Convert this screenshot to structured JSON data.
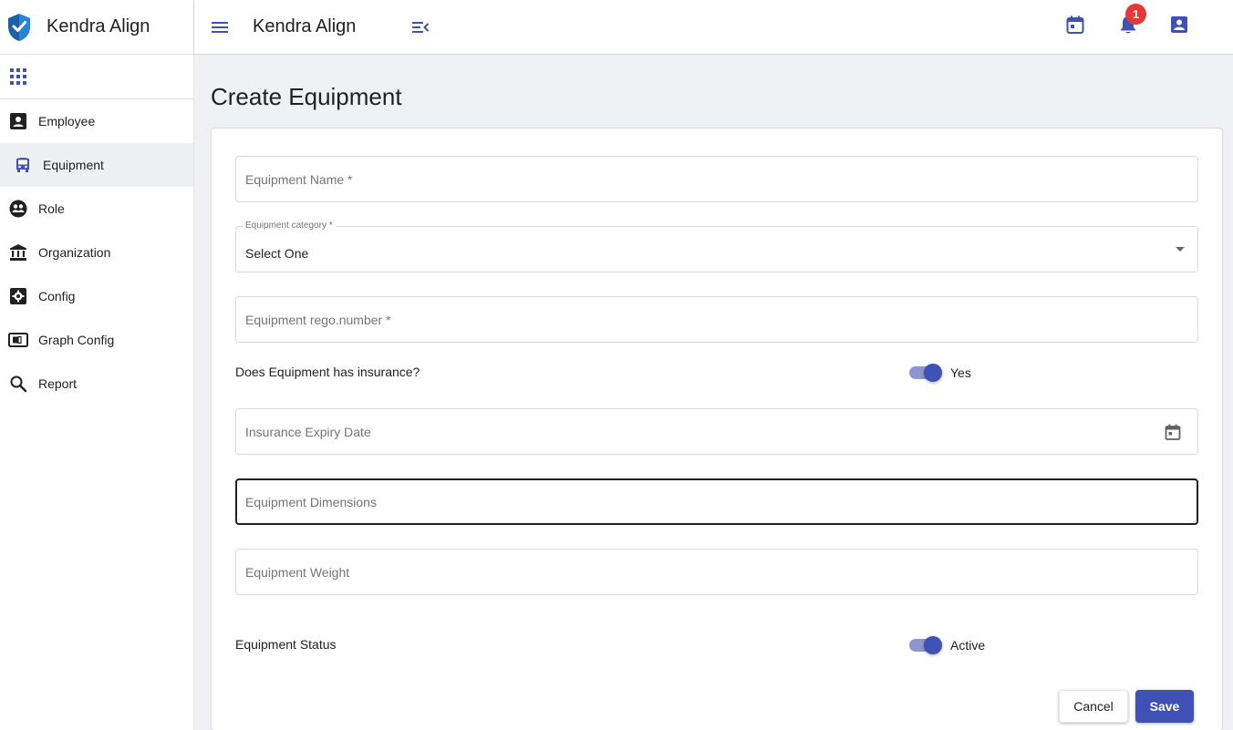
{
  "brand": {
    "name": "Kendra Align"
  },
  "colors": {
    "primary": "#3f51b5",
    "badge": "#e53935",
    "toggle_track": "#8e96cf",
    "main_bg": "#eff2f5"
  },
  "sidebar": {
    "items": [
      {
        "label": "Employee",
        "icon": "contact-card-icon"
      },
      {
        "label": "Equipment",
        "icon": "bus-icon",
        "active": true
      },
      {
        "label": "Role",
        "icon": "group-icon"
      },
      {
        "label": "Organization",
        "icon": "bank-icon"
      },
      {
        "label": "Config",
        "icon": "settings-box-icon"
      },
      {
        "label": "Graph Config",
        "icon": "switch-box-icon"
      },
      {
        "label": "Report",
        "icon": "search-icon"
      }
    ]
  },
  "header": {
    "title": "Kendra Align",
    "notification_count": "1"
  },
  "page": {
    "title": "Create Equipment"
  },
  "form": {
    "equipment_name": {
      "placeholder": "Equipment Name *"
    },
    "equipment_category": {
      "label": "Equipment category *",
      "value": "Select One"
    },
    "rego_number": {
      "placeholder": "Equipment rego.number *"
    },
    "insurance": {
      "label": "Does Equipment has insurance?",
      "toggle_label": "Yes",
      "checked": true
    },
    "insurance_expiry": {
      "placeholder": "Insurance Expiry Date"
    },
    "dimensions": {
      "placeholder": "Equipment Dimensions"
    },
    "weight": {
      "placeholder": "Equipment Weight"
    },
    "status": {
      "label": "Equipment Status",
      "toggle_label": "Active",
      "checked": true
    }
  },
  "actions": {
    "cancel_label": "Cancel",
    "save_label": "Save"
  }
}
